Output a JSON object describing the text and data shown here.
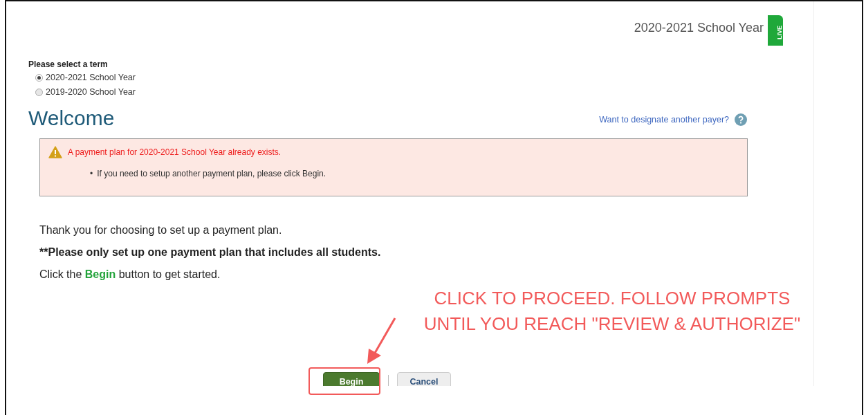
{
  "header": {
    "term": "2020-2021 School Year",
    "badge": "LIVE"
  },
  "term_select": {
    "label": "Please select a term",
    "options": [
      {
        "label": "2020-2021 School Year",
        "selected": true
      },
      {
        "label": "2019-2020 School Year",
        "selected": false
      }
    ]
  },
  "heading": "Welcome",
  "payer_link": "Want to designate another payer?",
  "alert": {
    "message": "A payment plan for 2020-2021 School Year already exists.",
    "items": [
      {
        "bullet": "•",
        "text": "If you need to setup another payment plan, please click Begin."
      }
    ]
  },
  "intro": [
    {
      "kind": "plain",
      "text": "Thank you for choosing to set up a payment plan."
    },
    {
      "kind": "bold",
      "text": "**Please only set up one payment plan that includes all students."
    },
    {
      "kind": "rich",
      "text": "Click the **Begin** button to get started."
    }
  ],
  "buttons": [
    {
      "label": "Begin",
      "kind": "primary"
    },
    {
      "label": "Cancel",
      "kind": "secondary"
    }
  ],
  "annotation": {
    "lines": [
      "CLICK TO PROCEED. FOLLOW PROMPTS",
      "UNTIL YOU REACH \"REVIEW & AUTHORIZE\""
    ]
  }
}
